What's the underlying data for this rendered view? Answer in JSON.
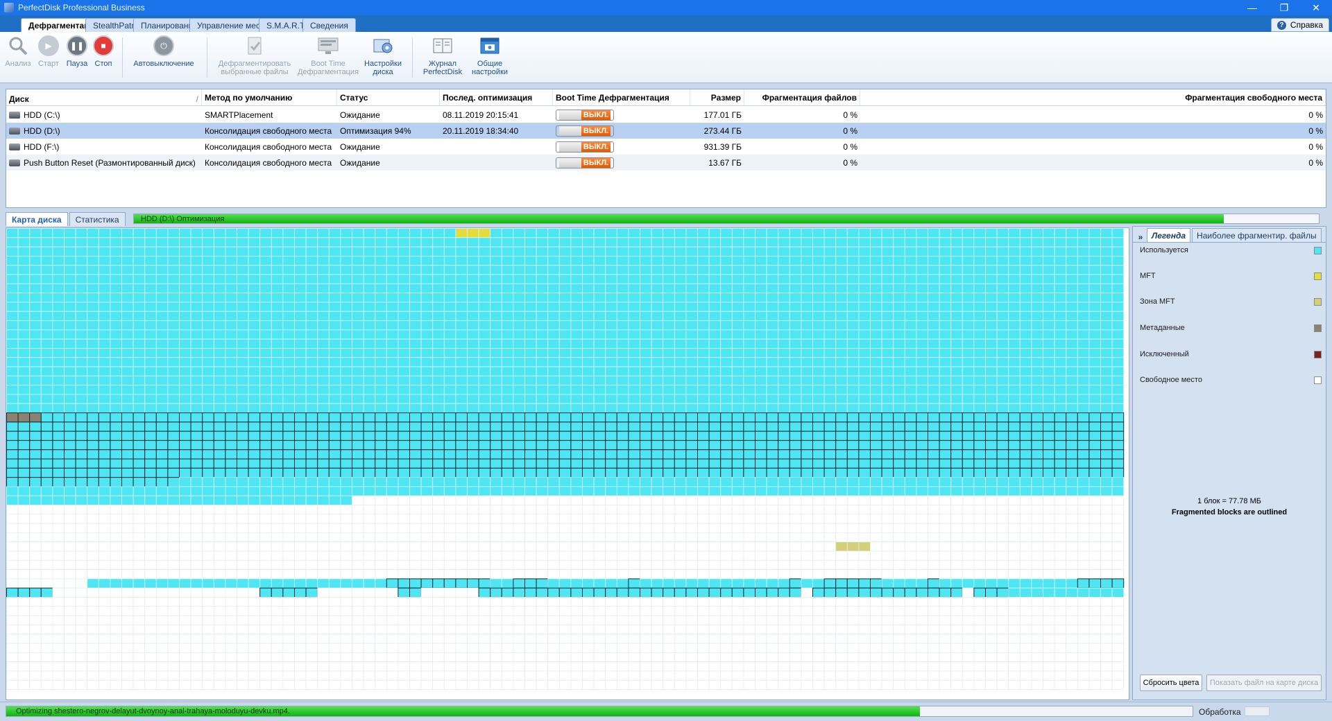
{
  "window": {
    "title": "PerfectDisk Professional Business",
    "controls": [
      "—",
      "❐",
      "✕"
    ]
  },
  "tabs": [
    {
      "label": "Дефрагментация",
      "active": true
    },
    {
      "label": "StealthPatrol"
    },
    {
      "label": "Планирование"
    },
    {
      "label": "Управление местом"
    },
    {
      "label": "S.M.A.R.T."
    },
    {
      "label": "Сведения"
    }
  ],
  "help": {
    "label": "Справка",
    "icon": "help-icon"
  },
  "ribbon": {
    "analyze": "Анализ",
    "start": "Старт",
    "pause": "Пауза",
    "stop": "Стоп",
    "autoshutdown": "Автовыключение",
    "defrag_selected": "Дефрагментировать выбранные файлы",
    "boot_time": "Boot Time Дефрагментация",
    "disk_settings": "Настройки диска",
    "journal": "Журнал PerfectDisk",
    "general_settings": "Общие настройки"
  },
  "disk_table": {
    "headers": [
      "Диск",
      "Метод по умолчанию",
      "Статус",
      "Послед. оптимизация",
      "Boot Time Дефрагментация",
      "Размер",
      "Фрагментация файлов",
      "Фрагментация свободного места"
    ],
    "sort_mark": "/",
    "rows": [
      {
        "disk": "HDD (C:\\)",
        "method": "SMARTPlacement",
        "status": "Ожидание",
        "last": "08.11.2019 20:15:41",
        "boot": "ВЫКЛ.",
        "size": "177.01 ГБ",
        "file_frag": "0 %",
        "free_frag": "0 %"
      },
      {
        "disk": "HDD (D:\\)",
        "method": "Консолидация свободного места",
        "status": "Оптимизация 94%",
        "last": "20.11.2019 18:34:40",
        "boot": "ВЫКЛ.",
        "size": "273.44 ГБ",
        "file_frag": "0 %",
        "free_frag": "0 %"
      },
      {
        "disk": "HDD (F:\\)",
        "method": "Консолидация свободного места",
        "status": "Ожидание",
        "last": "",
        "boot": "ВЫКЛ.",
        "size": "931.39 ГБ",
        "file_frag": "0 %",
        "free_frag": "0 %"
      },
      {
        "disk": "Push Button Reset (Размонтированный диск)",
        "method": "Консолидация свободного места",
        "status": "Ожидание",
        "last": "",
        "boot": "ВЫКЛ.",
        "size": "13.67 ГБ",
        "file_frag": "0 %",
        "free_frag": "0 %"
      }
    ]
  },
  "map_tabs": {
    "disk_map": "Карта диска",
    "statistics": "Статистика"
  },
  "top_progress": {
    "label": "HDD (D:\\)  Оптимизация",
    "fraction": 0.92
  },
  "legend": {
    "tabs": [
      "Легенда",
      "Наиболее фрагментир. файлы"
    ],
    "collapse_icon": "double-chevron-icon",
    "items": [
      {
        "label": "Используется",
        "color": "#4fe6f4"
      },
      {
        "label": "MFT",
        "color": "#e4dc3a"
      },
      {
        "label": "Зона MFT",
        "color": "#d6cf7a"
      },
      {
        "label": "Метаданные",
        "color": "#8c8272"
      },
      {
        "label": "Исключенный",
        "color": "#7a2323"
      },
      {
        "label": "Свободное место",
        "color": "#ffffff"
      }
    ],
    "block_size": "1 блок = 77.78 МБ",
    "outline_note": "Fragmented blocks are outlined",
    "reset_colors": "Сбросить цвета",
    "show_file": "Показать файл на карте диска"
  },
  "status_bar": {
    "progress_label": "Optimizing shestero-negrov-delayut-dvoynoy-anal-trahaya-moloduyu-devku.mp4.",
    "progress_fraction": 0.77,
    "status": "Обработка"
  }
}
